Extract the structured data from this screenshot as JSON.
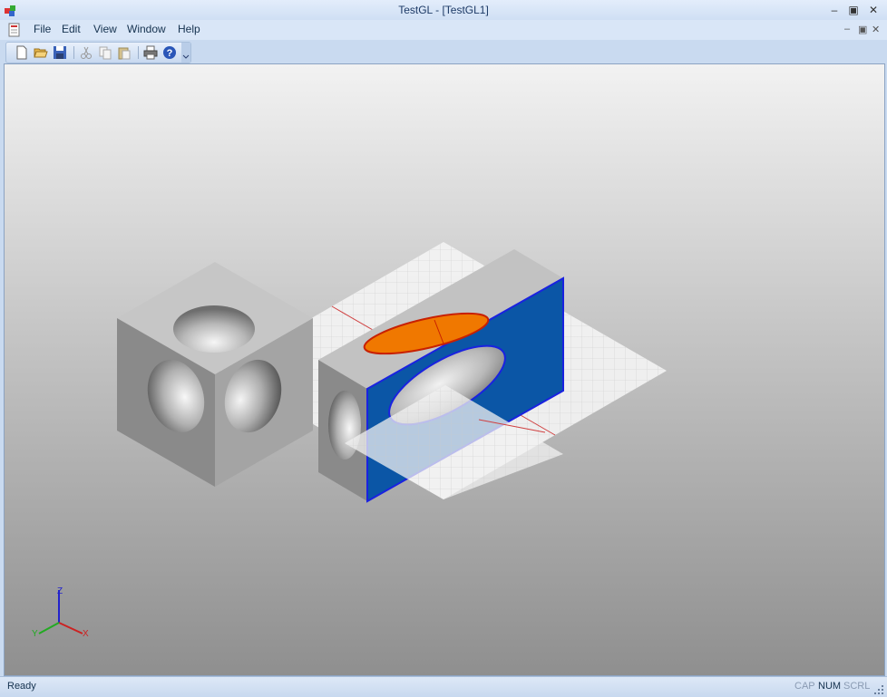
{
  "window": {
    "title": "TestGL - [TestGL1]"
  },
  "menu": {
    "items": [
      "File",
      "Edit",
      "View",
      "Window",
      "Help"
    ]
  },
  "toolbar": {
    "buttons": [
      "new-icon",
      "open-icon",
      "save-icon",
      "cut-icon",
      "copy-icon",
      "paste-icon",
      "print-icon",
      "help-icon"
    ]
  },
  "axes": {
    "x": "X",
    "y": "Y",
    "z": "Z"
  },
  "status": {
    "text": "Ready",
    "cap": "CAP",
    "num": "NUM",
    "scrl": "SCRL"
  },
  "colors": {
    "highlight_face": "#0b56a6",
    "highlight_edge": "#1a22e0",
    "ellipse_fill": "#f07800",
    "ellipse_edge": "#c82000",
    "grid_axis": "#d04040"
  }
}
